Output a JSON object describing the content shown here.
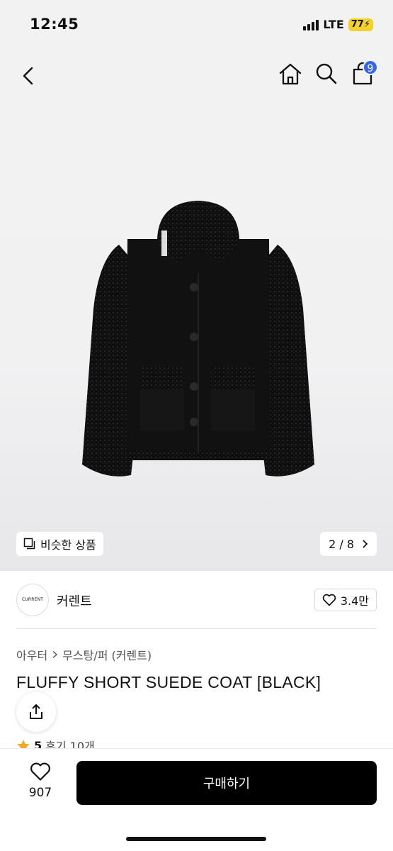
{
  "status_bar": {
    "time": "12:45",
    "network": "LTE",
    "battery": "77"
  },
  "nav": {
    "icons": [
      "back-chevron-icon",
      "home-icon",
      "search-icon",
      "shopping-bag-icon"
    ],
    "cart_count": "9"
  },
  "gallery": {
    "image": "black-fluffy-short-jacket",
    "similar_label": "비슷한 상품",
    "page": "2 / 8"
  },
  "brand": {
    "logo_text": "CURRENT",
    "name": "커렌트",
    "likes": "3.4만"
  },
  "product": {
    "breadcrumb": [
      "아우터",
      "무스탕/퍼 (커렌트)"
    ],
    "title": "FLUFFY SHORT SUEDE COAT [BLACK]",
    "rating_score": "5",
    "review_label": "후기 10개"
  },
  "bottom_bar": {
    "wish_count": "907",
    "buy_label": "구매하기"
  },
  "colors": {
    "accent_badge": "#3567e6",
    "star": "#f5a623",
    "buy_button": "#000000"
  }
}
